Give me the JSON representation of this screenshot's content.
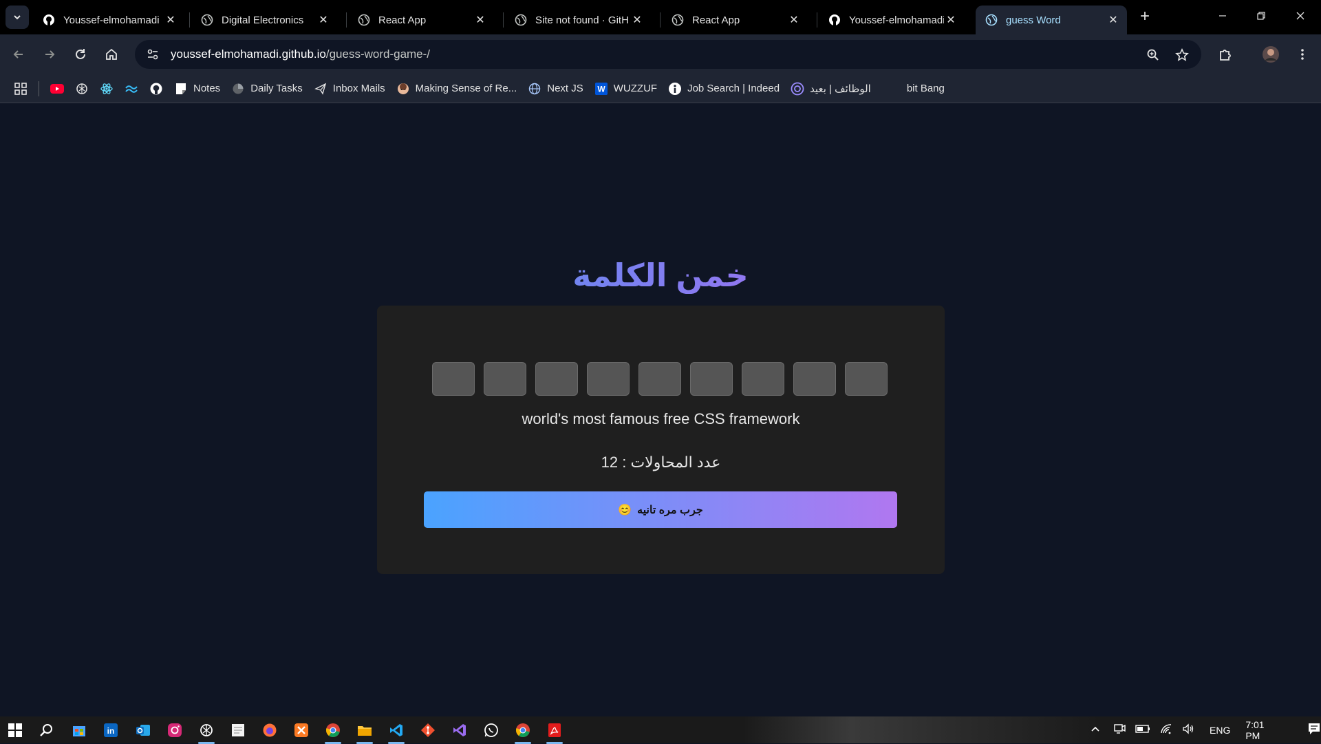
{
  "browser": {
    "tabs": [
      {
        "title": "Youssef-elmohamadi",
        "icon": "github-icon",
        "active": false
      },
      {
        "title": "Digital Electronics",
        "icon": "globe-icon",
        "active": false
      },
      {
        "title": "React App",
        "icon": "globe-icon",
        "active": false
      },
      {
        "title": "Site not found · GitH",
        "icon": "globe-icon",
        "active": false
      },
      {
        "title": "React App",
        "icon": "globe-icon",
        "active": false
      },
      {
        "title": "Youssef-elmohamadi",
        "icon": "github-icon",
        "active": false
      },
      {
        "title": "guess Word",
        "icon": "globe-icon",
        "active": true
      }
    ],
    "tab_close": "✕",
    "new_tab": "+",
    "url_host": "youssef-elmohamadi.github.io",
    "url_path": "/guess-word-game-/",
    "bookmarks": [
      {
        "label": "Notes",
        "icon": "notes-icon"
      },
      {
        "label": "Daily Tasks",
        "icon": "clock-icon"
      },
      {
        "label": "Inbox Mails",
        "icon": "mail-icon"
      },
      {
        "label": "Making Sense of Re...",
        "icon": "avatar-icon"
      },
      {
        "label": "Next JS",
        "icon": "globe-icon"
      },
      {
        "label": "WUZZUF",
        "icon": "wuzzuf-icon"
      },
      {
        "label": "Job Search | Indeed",
        "icon": "indeed-icon"
      },
      {
        "label": "الوظائف | بعيد",
        "icon": "baeed-icon"
      },
      {
        "label": "bit Bang",
        "icon": "none"
      }
    ]
  },
  "game": {
    "title": "خمن الكلمة",
    "letter_count": 9,
    "hint": "world's most famous free CSS framework",
    "attempts_label": "عدد المحاولات : ",
    "attempts_value": "12",
    "retry_label": "جرب مره تانيه",
    "retry_emoji": "😊"
  },
  "taskbar": {
    "lang": "ENG",
    "time": "7:01 PM"
  },
  "colors": {
    "page_bg": "#0f1524",
    "card_bg": "#1f1f1f",
    "title_gradient": [
      "#5d8df0",
      "#a56ef0"
    ],
    "button_gradient": [
      "#4aa3ff",
      "#b077f0"
    ],
    "active_tab_text": "#a8e0ff"
  }
}
